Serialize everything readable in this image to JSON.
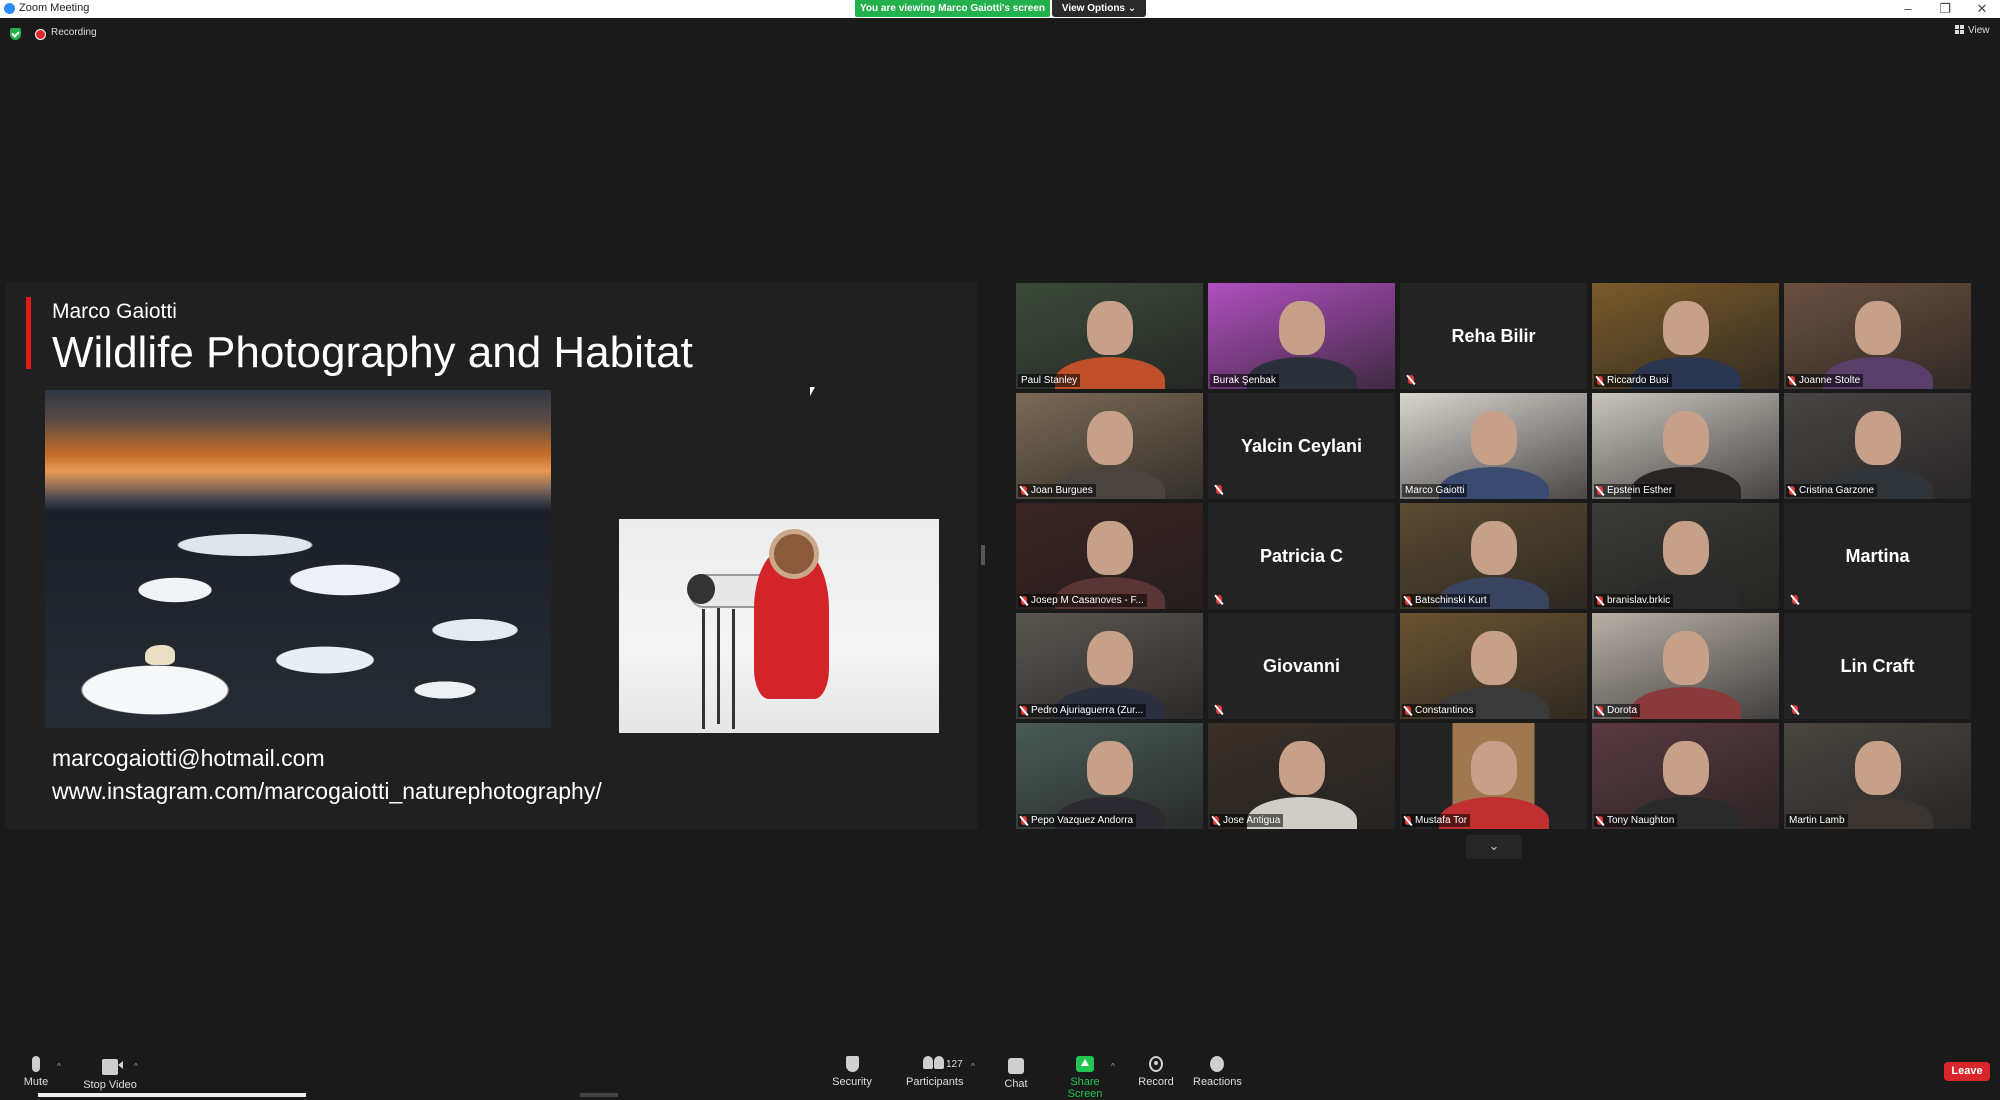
{
  "window": {
    "title": "Zoom Meeting",
    "share_banner": "You are viewing Marco Gaiotti's screen",
    "view_options": "View Options",
    "minimize": "–",
    "restore": "❐",
    "close": "✕"
  },
  "topbar": {
    "recording_label": "Recording",
    "view_label": "View"
  },
  "slide": {
    "presenter": "Marco Gaiotti",
    "headline": "Wildlife Photography and Habitat",
    "email": "marcogaiotti@hotmail.com",
    "instagram": "www.instagram.com/marcogaiotti_naturephotography/"
  },
  "gallery": {
    "next_glyph": "⌄",
    "tiles": [
      {
        "name": "Paul Stanley",
        "video": true,
        "muted": false,
        "bg": "#3c4a3a",
        "shirt": "#c0502a"
      },
      {
        "name": "Burak Şenbak",
        "video": true,
        "muted": false,
        "bg": "#b04fbf",
        "shirt": "#2a2f3a"
      },
      {
        "name": "Reha Bilir",
        "video": false,
        "muted": true
      },
      {
        "name": "Riccardo Busi",
        "video": true,
        "muted": true,
        "bg": "#7a5a2a",
        "shirt": "#2a3550"
      },
      {
        "name": "Joanne Stolte",
        "video": true,
        "muted": true,
        "bg": "#6a5040",
        "shirt": "#5a3f6a"
      },
      {
        "name": "Joan Burgues",
        "video": true,
        "muted": true,
        "bg": "#7a6a55",
        "shirt": "#4a4340"
      },
      {
        "name": "Yalcin Ceylani",
        "video": false,
        "muted": true
      },
      {
        "name": "Marco Gaiotti",
        "video": true,
        "muted": false,
        "bg": "#d9d5cf",
        "shirt": "#3a4a70",
        "speaking": true
      },
      {
        "name": "Epstein Esther",
        "video": true,
        "muted": true,
        "bg": "#c9c4bd",
        "shirt": "#2a2525"
      },
      {
        "name": "Cristina Garzone",
        "video": true,
        "muted": true,
        "bg": "#4a4444",
        "shirt": "#2f3438"
      },
      {
        "name": "Josep M Casanoves - F...",
        "video": true,
        "muted": true,
        "bg": "#3a2222",
        "shirt": "#5a3535"
      },
      {
        "name": "Patricia C",
        "video": false,
        "muted": true
      },
      {
        "name": "Batschinski Kurt",
        "video": true,
        "muted": true,
        "bg": "#5a4a30",
        "shirt": "#3a4460"
      },
      {
        "name": "branislav.brkic",
        "video": true,
        "muted": true,
        "bg": "#3a3a35",
        "shirt": "#2a2a2a"
      },
      {
        "name": "Martina",
        "video": false,
        "muted": true
      },
      {
        "name": "Pedro Ajuriaguerra (Zur...",
        "video": true,
        "muted": true,
        "bg": "#5a5550",
        "shirt": "#2a3040"
      },
      {
        "name": "Giovanni",
        "video": false,
        "muted": true
      },
      {
        "name": "Constantinos",
        "video": true,
        "muted": true,
        "bg": "#6a5230",
        "shirt": "#3a3a3a"
      },
      {
        "name": "Dorota",
        "video": true,
        "muted": true,
        "bg": "#b8b0a8",
        "shirt": "#8a3a3a"
      },
      {
        "name": "Lin Craft",
        "video": false,
        "muted": true
      },
      {
        "name": "Pepo Vazquez Andorra",
        "video": true,
        "muted": true,
        "bg": "#4a5a55",
        "shirt": "#2a2a30"
      },
      {
        "name": "Jose Antigua",
        "video": true,
        "muted": true,
        "bg": "#3a3028",
        "shirt": "#d0ccc6"
      },
      {
        "name": "Mustafa Tor",
        "video": true,
        "muted": true,
        "bg": "#a07850",
        "shirt": "#c03030",
        "narrow": true
      },
      {
        "name": "Tony Naughton",
        "video": true,
        "muted": true,
        "bg": "#5a3a40",
        "shirt": "#2a2a2a"
      },
      {
        "name": "Martin Lamb",
        "video": true,
        "muted": false,
        "bg": "#4a4540",
        "shirt": "#3a3530"
      }
    ]
  },
  "toolbar": {
    "mute": "Mute",
    "stop_video": "Stop Video",
    "security": "Security",
    "participants": "Participants",
    "participants_count": "127",
    "chat": "Chat",
    "share_screen": "Share Screen",
    "record": "Record",
    "reactions": "Reactions",
    "leave": "Leave",
    "caret": "^"
  },
  "colors": {
    "share_green": "#23b14d",
    "leave_red": "#d9262b",
    "slide_accent": "#e31b1b",
    "speaker_outline": "#e5ee4d"
  }
}
